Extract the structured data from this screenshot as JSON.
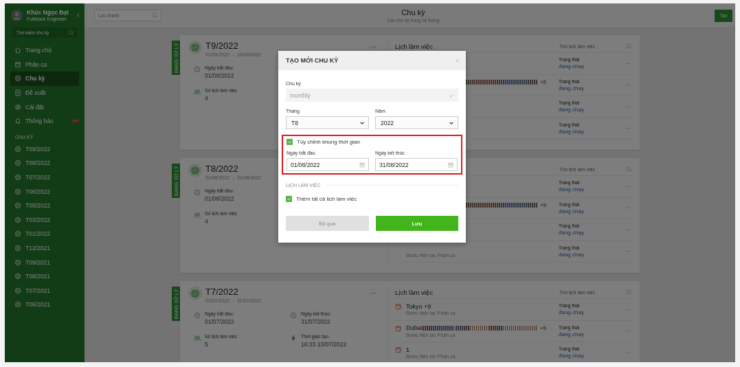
{
  "sidebar": {
    "user": {
      "name": "Khúc Ngọc Đạt",
      "role": "Fullstack Engineer"
    },
    "search": {
      "placeholder": "Tìm kiếm chu kỳ"
    },
    "nav": [
      {
        "label": "Trang chủ",
        "kind": "home",
        "selected": false,
        "badge": false
      },
      {
        "label": "Phân ca",
        "kind": "shift",
        "selected": false,
        "badge": false
      },
      {
        "label": "Chu kỳ",
        "kind": "cycle",
        "selected": true,
        "badge": false
      },
      {
        "label": "Đề xuất",
        "kind": "doc",
        "selected": false,
        "badge": false
      },
      {
        "label": "Cài đặt",
        "kind": "gear",
        "selected": false,
        "badge": false
      },
      {
        "label": "Thông báo",
        "kind": "bell",
        "selected": false,
        "badge": true
      }
    ],
    "section": "CHU KỲ",
    "cycles": [
      "T09/2022",
      "T08/2022",
      "T07/2022",
      "T06/2022",
      "T05/2022",
      "T03/2022",
      "T01/2022",
      "T12/2021",
      "T09/2021",
      "T08/2021",
      "T07/2021",
      "T06/2021"
    ]
  },
  "header": {
    "search": {
      "placeholder": "Lọc nhanh"
    },
    "title": "Chu kỳ",
    "subtitle": "Các chu kỳ trong hệ thống",
    "create_button": "Tạo"
  },
  "cards": [
    {
      "status": "ĐANG XỬ LÝ",
      "title": "T9/2022",
      "range": "01/09/2022 → 15/09/2022",
      "menu": true,
      "field_rows": [
        [
          {
            "kind": "clock",
            "label": "Ngày bắt đầu:",
            "value": "01/09/2022"
          }
        ],
        [
          {
            "kind": "team",
            "label": "Số lịch làm việc",
            "value": "4"
          }
        ]
      ],
      "schedules": {
        "title": "Lịch làm việc",
        "search_placeholder": "Tìm lịch làm việc",
        "rows": [
          {
            "status_label": "Trạng thái",
            "status": "đang chạy"
          },
          {
            "striped": true,
            "tail": "+5",
            "status_label": "Trạng thái",
            "status": "đang chạy"
          },
          {
            "status_label": "Trạng thái",
            "status": "đang chạy"
          },
          {
            "status_label": "Trạng thái",
            "status": "đang chạy"
          }
        ]
      }
    },
    {
      "status": "ĐANG XỬ LÝ",
      "title": "T8/2022",
      "range": "01/08/2022 → 31/08/2022",
      "field_rows": [
        [
          {
            "kind": "clock",
            "label": "Ngày bắt đầu:",
            "value": "01/08/2022"
          }
        ],
        [
          {
            "kind": "team",
            "label": "Số lịch làm việc",
            "value": "4"
          }
        ]
      ],
      "schedules": {
        "search_placeholder": "Tìm lịch làm việc",
        "rows": [
          {
            "status_label": "Trạng thái",
            "status": "đang chạy"
          },
          {
            "striped": true,
            "tail": "+5",
            "status_label": "Trạng thái",
            "status": "đang chạy"
          },
          {
            "status_label": "Trạng thái",
            "status": "đang chạy"
          },
          {
            "sub": "Bước hiện tại: Phân ca",
            "status_label": "Trạng thái",
            "status": "đang chạy"
          }
        ]
      }
    },
    {
      "status": "ĐANG XỬ LÝ",
      "title": "T7/2022",
      "range": "01/07/2022 → 31/07/2022",
      "menu": true,
      "field_rows": [
        [
          {
            "kind": "clock",
            "label": "Ngày bắt đầu:",
            "value": "01/07/2022"
          },
          {
            "kind": "clock",
            "label": "Ngày kết thúc:",
            "value": "31/07/2022"
          }
        ],
        [
          {
            "kind": "team",
            "label": "Số lịch làm việc",
            "value": "5"
          },
          {
            "kind": "bolt",
            "label": "Thời gian tạo",
            "value": "16:33 13/07/2022"
          }
        ]
      ],
      "schedules": {
        "title": "Lịch làm việc",
        "search_placeholder": "Tìm lịch làm việc",
        "rows": [
          {
            "icon": true,
            "name": "Tokyo +9",
            "sub": "Bước hiện tại: Phân ca",
            "status_label": "Trạng thái",
            "status": "đang chạy"
          },
          {
            "icon": true,
            "name": "Dubai",
            "striped": true,
            "tail": "+5",
            "sub": "Bước hiện tại: Phân ca",
            "status_label": "Trạng thái",
            "status": "đang chạy"
          },
          {
            "icon": true,
            "name": "1",
            "sub": "Bước hiện tại: Phân ca",
            "status_label": "Trạng thái",
            "status": "đang chạy"
          }
        ]
      }
    }
  ],
  "modal": {
    "title": "TẠO MỚI CHU KỲ",
    "cycle": {
      "label": "Chu kỳ",
      "value": "monthly",
      "disabled": true
    },
    "month": {
      "label": "Tháng",
      "value": "T8"
    },
    "year": {
      "label": "Năm",
      "value": "2022"
    },
    "custom_range": {
      "highlighted": true,
      "checkbox": {
        "label": "Tùy chỉnh khung thời gian",
        "checked": true
      },
      "start": {
        "label": "Ngày bắt đầu",
        "value": "01/08/2022"
      },
      "end": {
        "label": "Ngày kết thúc",
        "value": "31/08/2022"
      }
    },
    "section": "LỊCH LÀM VIỆC",
    "add_all": {
      "label": "Thêm tất cả lịch làm việc",
      "checked": true
    },
    "buttons": [
      {
        "label": "Bỏ qua",
        "kind": "secondary"
      },
      {
        "label": "Lưu",
        "kind": "primary"
      }
    ]
  }
}
